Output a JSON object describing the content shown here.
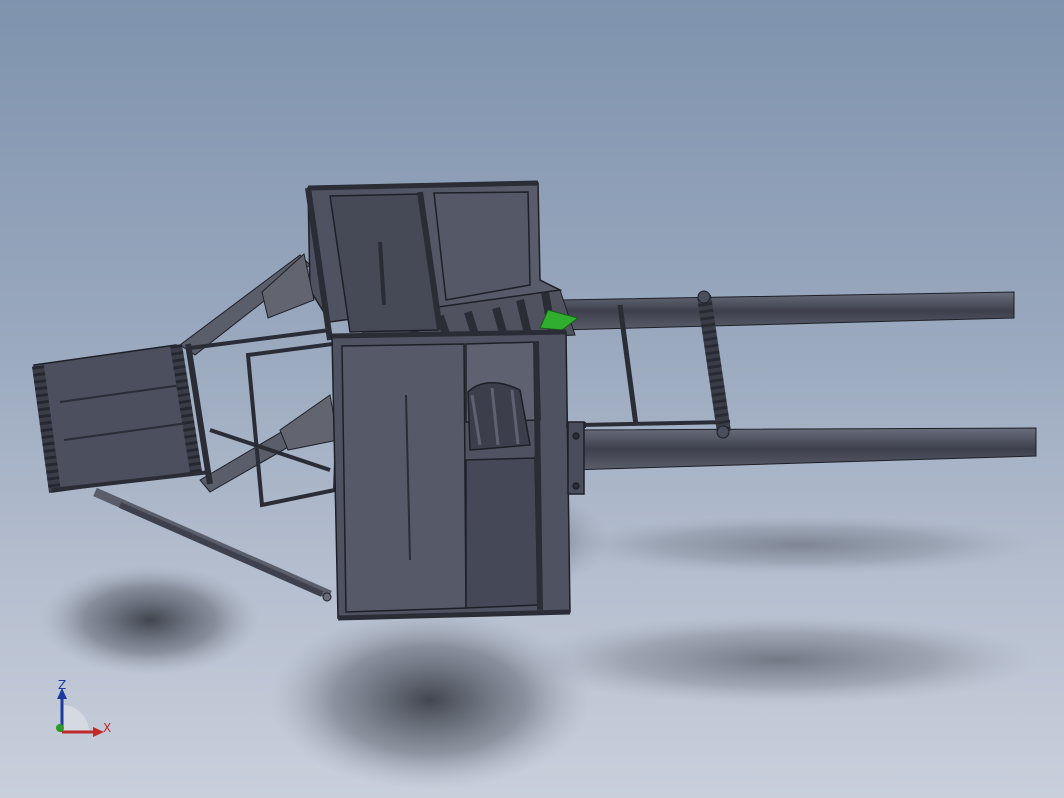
{
  "viewport": {
    "background_top": "#7f93ae",
    "background_bottom": "#c9d0dc",
    "model_body_color": "#4a4d5c",
    "model_edge_color": "#1e2028",
    "highlight_part_color": "#2fae2f"
  },
  "triad": {
    "z_label": "Z",
    "x_label": "X",
    "z_color": "#1d3a9e",
    "x_color": "#c0282a",
    "y_color": "#2a9a2a"
  }
}
